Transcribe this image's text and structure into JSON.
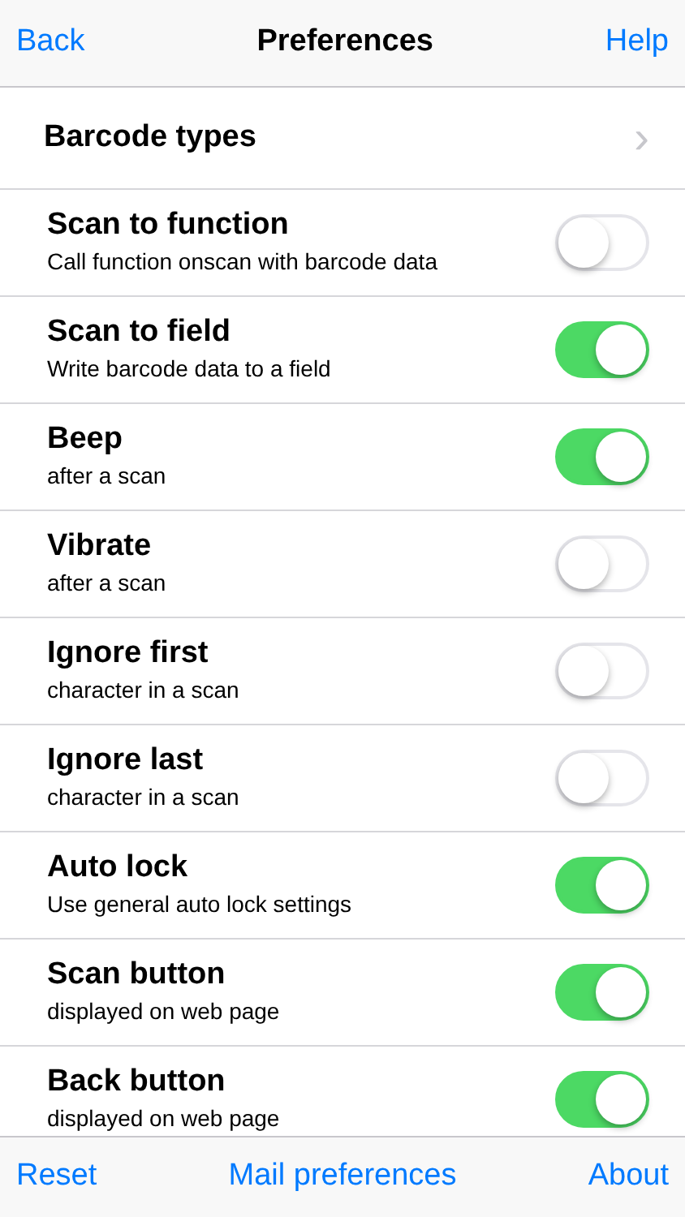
{
  "nav_bar": {
    "back": "Back",
    "title": "Preferences",
    "help": "Help"
  },
  "link_row": {
    "label": "Barcode types",
    "chevron": "›"
  },
  "settings": [
    {
      "title": "Scan to function",
      "subtitle": "Call function onscan with barcode data",
      "on": false
    },
    {
      "title": "Scan to field",
      "subtitle": "Write barcode data to a field",
      "on": true
    },
    {
      "title": "Beep",
      "subtitle": "after a scan",
      "on": true
    },
    {
      "title": "Vibrate",
      "subtitle": "after a scan",
      "on": false
    },
    {
      "title": "Ignore first",
      "subtitle": "character in a scan",
      "on": false
    },
    {
      "title": "Ignore last",
      "subtitle": "character in a scan",
      "on": false
    },
    {
      "title": "Auto lock",
      "subtitle": "Use general auto lock settings",
      "on": true
    },
    {
      "title": "Scan button",
      "subtitle": "displayed on web page",
      "on": true
    },
    {
      "title": "Back button",
      "subtitle": "displayed on web page",
      "on": true
    }
  ],
  "toolbar": [
    "Reset",
    "Mail preferences",
    "About"
  ]
}
